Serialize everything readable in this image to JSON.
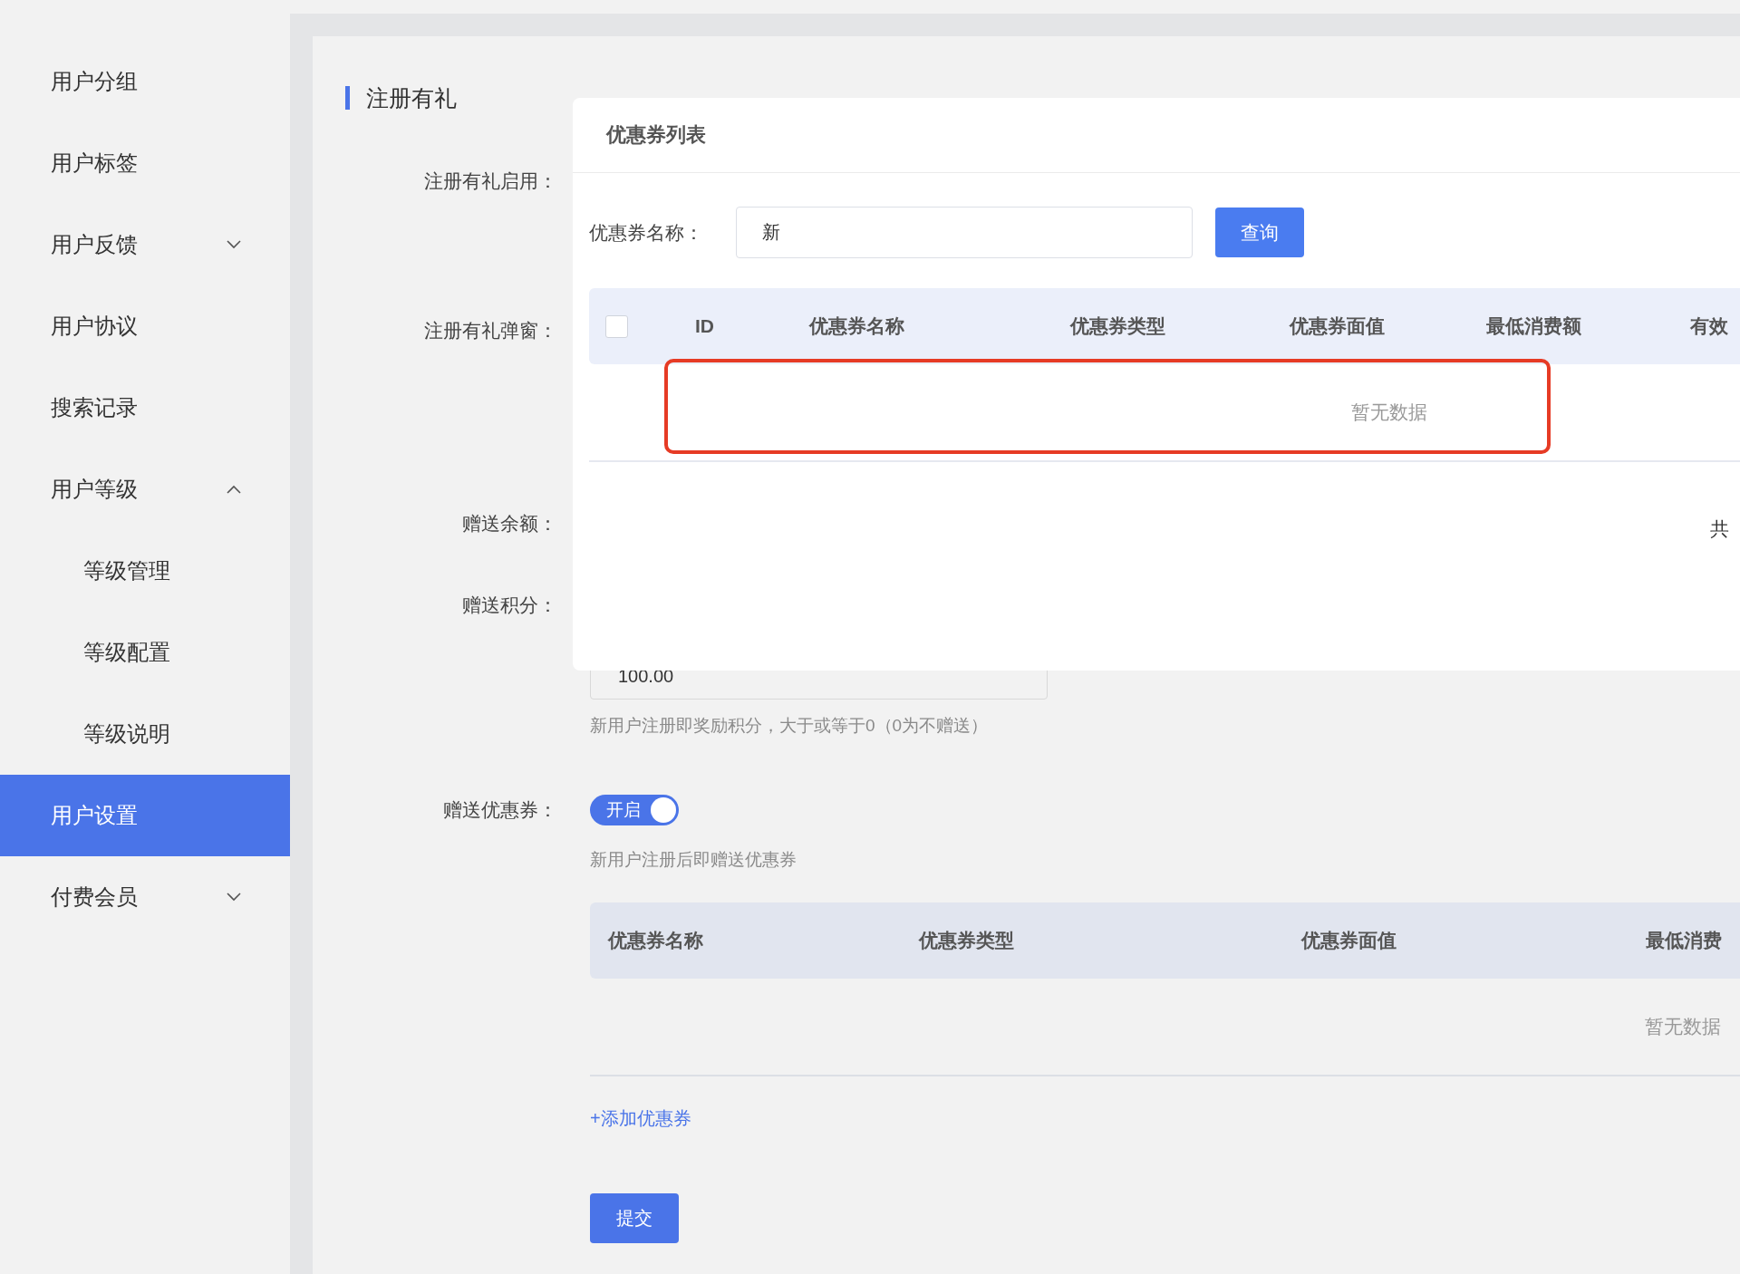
{
  "sidebar": {
    "items": [
      {
        "label": "用户分组",
        "kind": "link",
        "selected": false
      },
      {
        "label": "用户标签",
        "kind": "link",
        "selected": false
      },
      {
        "label": "用户反馈",
        "kind": "group",
        "expanded": false,
        "selected": false
      },
      {
        "label": "用户协议",
        "kind": "link",
        "selected": false
      },
      {
        "label": "搜索记录",
        "kind": "link",
        "selected": false
      },
      {
        "label": "用户等级",
        "kind": "group",
        "expanded": true,
        "selected": false,
        "children": [
          {
            "label": "等级管理",
            "selected": false
          },
          {
            "label": "等级配置",
            "selected": false
          },
          {
            "label": "等级说明",
            "selected": false
          }
        ]
      },
      {
        "label": "用户设置",
        "kind": "link",
        "selected": true
      },
      {
        "label": "付费会员",
        "kind": "group",
        "expanded": false,
        "selected": false
      }
    ]
  },
  "section_title": "注册有礼",
  "form": {
    "fields": [
      {
        "kind": "covered",
        "label": "注册有礼启用："
      },
      {
        "kind": "covered",
        "label": "注册有礼弹窗："
      },
      {
        "kind": "covered",
        "label": "赠送余额："
      },
      {
        "kind": "input",
        "label": "赠送积分：",
        "value": "100.00",
        "hint": "新用户注册即奖励积分，大于或等于0（0为不赠送）"
      },
      {
        "kind": "switch",
        "label": "赠送优惠券：",
        "on": true,
        "switch_text": "开启",
        "hint": "新用户注册后即赠送优惠券"
      }
    ]
  },
  "coupon_table": {
    "columns": [
      "优惠券名称",
      "优惠券类型",
      "优惠券面值",
      "最低消费"
    ],
    "empty_text": "暂无数据"
  },
  "add_link": "+添加优惠券",
  "submit": "提交",
  "dialog": {
    "title": "优惠券列表",
    "search": {
      "label": "优惠券名称：",
      "value": "新",
      "button": "查询"
    },
    "table": {
      "select_all_checked": false,
      "columns": [
        "ID",
        "优惠券名称",
        "优惠券类型",
        "优惠券面值",
        "最低消费额",
        "有效"
      ],
      "empty_text": "暂无数据"
    },
    "pagination_text": "共"
  }
}
